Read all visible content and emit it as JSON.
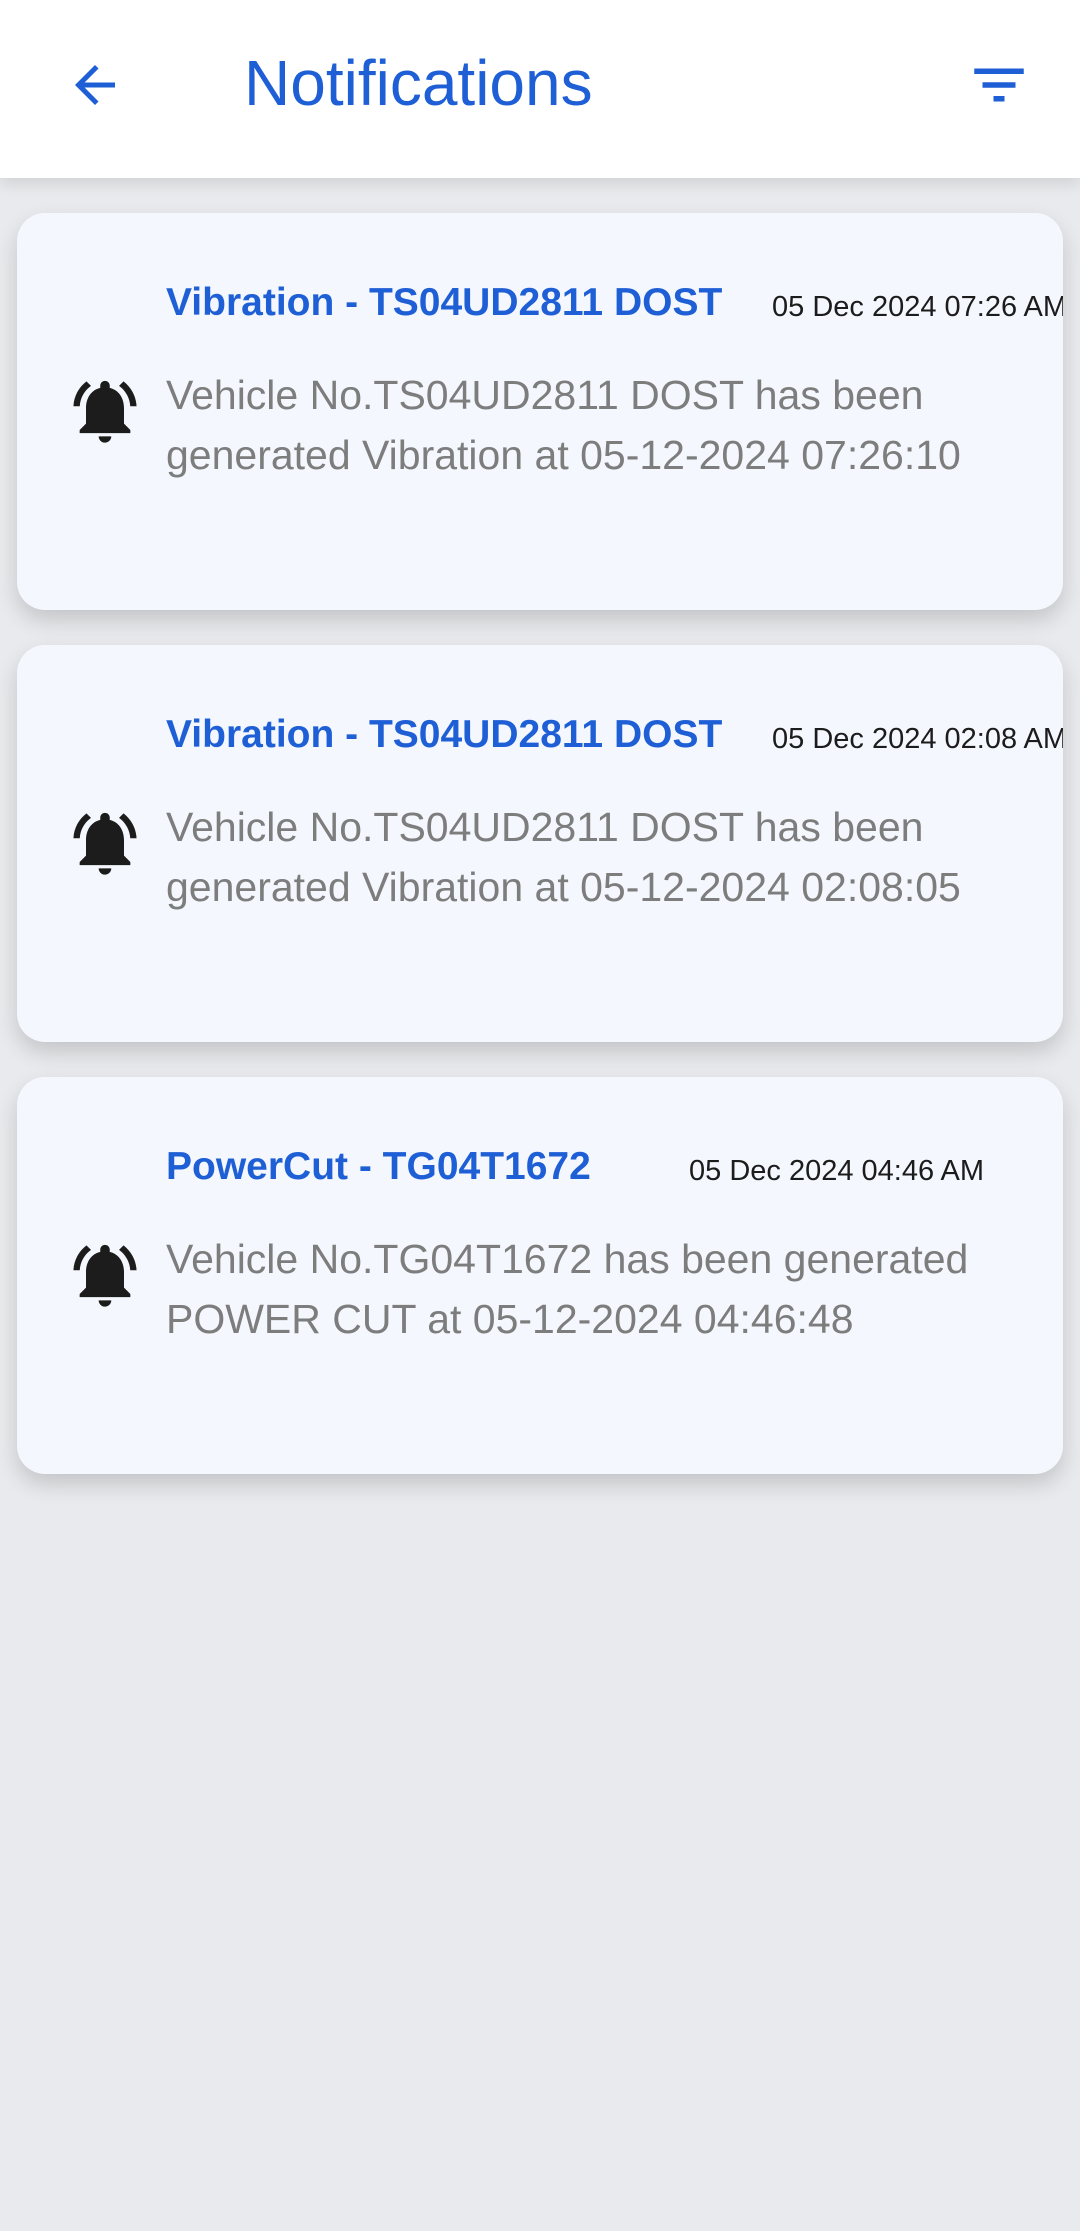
{
  "header": {
    "title": "Notifications",
    "back_icon": "arrow-left-icon",
    "filter_icon": "filter-icon",
    "accent": "#1f5fd6"
  },
  "notifications": [
    {
      "title": "Vibration - TS04UD2811 DOST",
      "date": "05 Dec 2024 07:26 AM",
      "body": "Vehicle No.TS04UD2811 DOST has been generated Vibration at 05-12-2024 07:26:10",
      "icon": "bell-ringing-icon"
    },
    {
      "title": "Vibration - TS04UD2811 DOST",
      "date": "05 Dec 2024 02:08 AM",
      "body": "Vehicle No.TS04UD2811 DOST has been generated Vibration at 05-12-2024 02:08:05",
      "icon": "bell-ringing-icon"
    },
    {
      "title": "PowerCut - TG04T1672",
      "date": "05 Dec 2024 04:46 AM",
      "body": "Vehicle No.TG04T1672 has been generated POWER CUT at 05-12-2024 04:46:48",
      "icon": "bell-ringing-icon"
    }
  ]
}
